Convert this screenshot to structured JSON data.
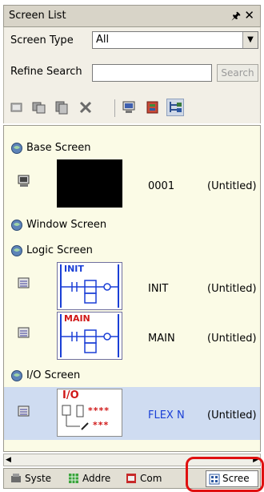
{
  "panel": {
    "title": "Screen List",
    "pin_icon": "pin-icon",
    "close_icon": "close-icon"
  },
  "screen_type": {
    "label": "Screen Type",
    "value": "All"
  },
  "refine": {
    "label": "Refine Search",
    "value": "",
    "button": "Search"
  },
  "toolbar": {
    "icons": [
      "new-screen-icon",
      "duplicate-icon",
      "copy-icon",
      "delete-icon",
      "monitor-icon",
      "screen-properties-icon",
      "tree-view-icon"
    ]
  },
  "list": {
    "categories": [
      {
        "label": "Base Screen"
      },
      {
        "label": "Window Screen"
      },
      {
        "label": "Logic Screen"
      },
      {
        "label": "I/O Screen"
      }
    ],
    "items": [
      {
        "number": "0001",
        "title": "(Untitled)",
        "thumb_kind": "black"
      },
      {
        "number": "INIT",
        "title": "(Untitled)",
        "thumb_kind": "ladder",
        "thumb_text": "INIT"
      },
      {
        "number": "MAIN",
        "title": "(Untitled)",
        "thumb_kind": "ladder",
        "thumb_text": "MAIN"
      },
      {
        "number": "FLEX N",
        "title": "(Untitled)",
        "thumb_kind": "io",
        "thumb_text": "I/O",
        "thumb_line1": "****",
        "thumb_line2": "***",
        "selected": true
      }
    ]
  },
  "tabs": [
    {
      "label": "Syste",
      "icon": "system-icon"
    },
    {
      "label": "Addre",
      "icon": "address-icon"
    },
    {
      "label": "Com",
      "icon": "comment-icon"
    },
    {
      "label": "Scree",
      "icon": "screen-list-icon",
      "active": true
    }
  ],
  "colors": {
    "selection": "#cfdcf1",
    "list_bg": "#fbfbe6",
    "highlight": "#e01010",
    "ladder_blue": "#1a3fd6",
    "io_red": "#d01818"
  }
}
